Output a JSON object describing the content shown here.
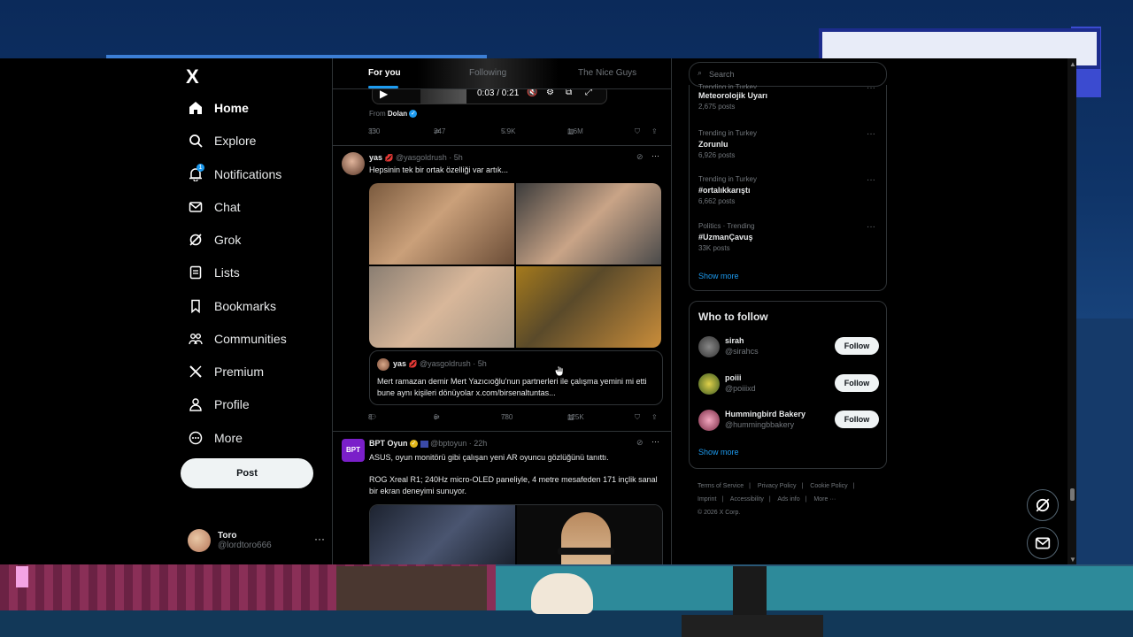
{
  "nav": {
    "logo": "X",
    "items": [
      {
        "label": "Home",
        "icon": "home-icon"
      },
      {
        "label": "Explore",
        "icon": "search-icon"
      },
      {
        "label": "Notifications",
        "icon": "bell-icon",
        "badge": "1"
      },
      {
        "label": "Chat",
        "icon": "mail-icon"
      },
      {
        "label": "Grok",
        "icon": "grok-icon"
      },
      {
        "label": "Lists",
        "icon": "list-icon"
      },
      {
        "label": "Bookmarks",
        "icon": "bookmark-icon"
      },
      {
        "label": "Communities",
        "icon": "communities-icon"
      },
      {
        "label": "Premium",
        "icon": "x-icon"
      },
      {
        "label": "Profile",
        "icon": "person-icon"
      },
      {
        "label": "More",
        "icon": "more-circle-icon"
      }
    ],
    "post_label": "Post",
    "account": {
      "name": "Toro",
      "handle": "@lordtoro666",
      "more": "···"
    }
  },
  "feed": {
    "tabs": [
      "For you",
      "Following",
      "The Nice Guys"
    ],
    "video": {
      "time": "0:03 / 0:21"
    },
    "from": {
      "prefix": "From",
      "name": "Dolan"
    },
    "top_actions": {
      "replies": "330",
      "reposts": "347",
      "likes": "5.9K",
      "views": "1.6M"
    },
    "tweet1": {
      "name": "yas",
      "handle": "@yasgoldrush",
      "time": "· 5h",
      "text": "Hepsinin tek bir ortak özelliği var artık...",
      "quote": {
        "name": "yas",
        "handle": "@yasgoldrush",
        "time": "· 5h",
        "text": "Mert ramazan demir Mert Yazıcıoğlu'nun partnerleri ile çalışma yemini mi etti bune aynı kişileri dönüyolar x.com/birsenaltuntas..."
      },
      "actions": {
        "replies": "8",
        "reposts": "6",
        "likes": "780",
        "views": "125K"
      }
    },
    "tweet2": {
      "avatar_text": "BPT",
      "name": "BPT Oyun",
      "handle": "@bptoyun",
      "time": "· 22h",
      "text1": "ASUS, oyun monitörü gibi çalışan yeni AR oyuncu gözlüğünü tanıttı.",
      "text2": "ROG Xreal R1; 240Hz micro-OLED paneliyle, 4 metre mesafeden 171 inçlik sanal bir ekran deneyimi sunuyor."
    }
  },
  "sidebar": {
    "search_placeholder": "Search",
    "trends": [
      {
        "category": "Trending in Turkey",
        "name": "Meteorolojik Uyarı",
        "count": "2,675 posts"
      },
      {
        "category": "Trending in Turkey",
        "name": "Zorunlu",
        "count": "6,926 posts"
      },
      {
        "category": "Trending in Turkey",
        "name": "#ortalıkkarıştı",
        "count": "6,662 posts"
      },
      {
        "category": "Politics · Trending",
        "name": "#UzmanÇavuş",
        "count": "33K posts"
      }
    ],
    "show_more": "Show more",
    "who_to_follow": {
      "title": "Who to follow",
      "users": [
        {
          "name": "sirah",
          "handle": "@sirahcs"
        },
        {
          "name": "poiii",
          "handle": "@poiiixd"
        },
        {
          "name": "Hummingbird Bakery",
          "handle": "@hummingbbakery"
        }
      ],
      "follow_label": "Follow",
      "show_more": "Show more"
    },
    "footer": [
      "Terms of Service",
      "|",
      "Privacy Policy",
      "|",
      "Cookie Policy",
      "|",
      "Imprint",
      "|",
      "Accessibility",
      "|",
      "Ads info",
      "|",
      "More ···",
      "© 2026 X Corp."
    ]
  },
  "colors": {
    "accent": "#1d9bf0",
    "background": "#000000",
    "text": "#e7e9ea",
    "muted": "#71767b",
    "border": "#2f3336"
  }
}
